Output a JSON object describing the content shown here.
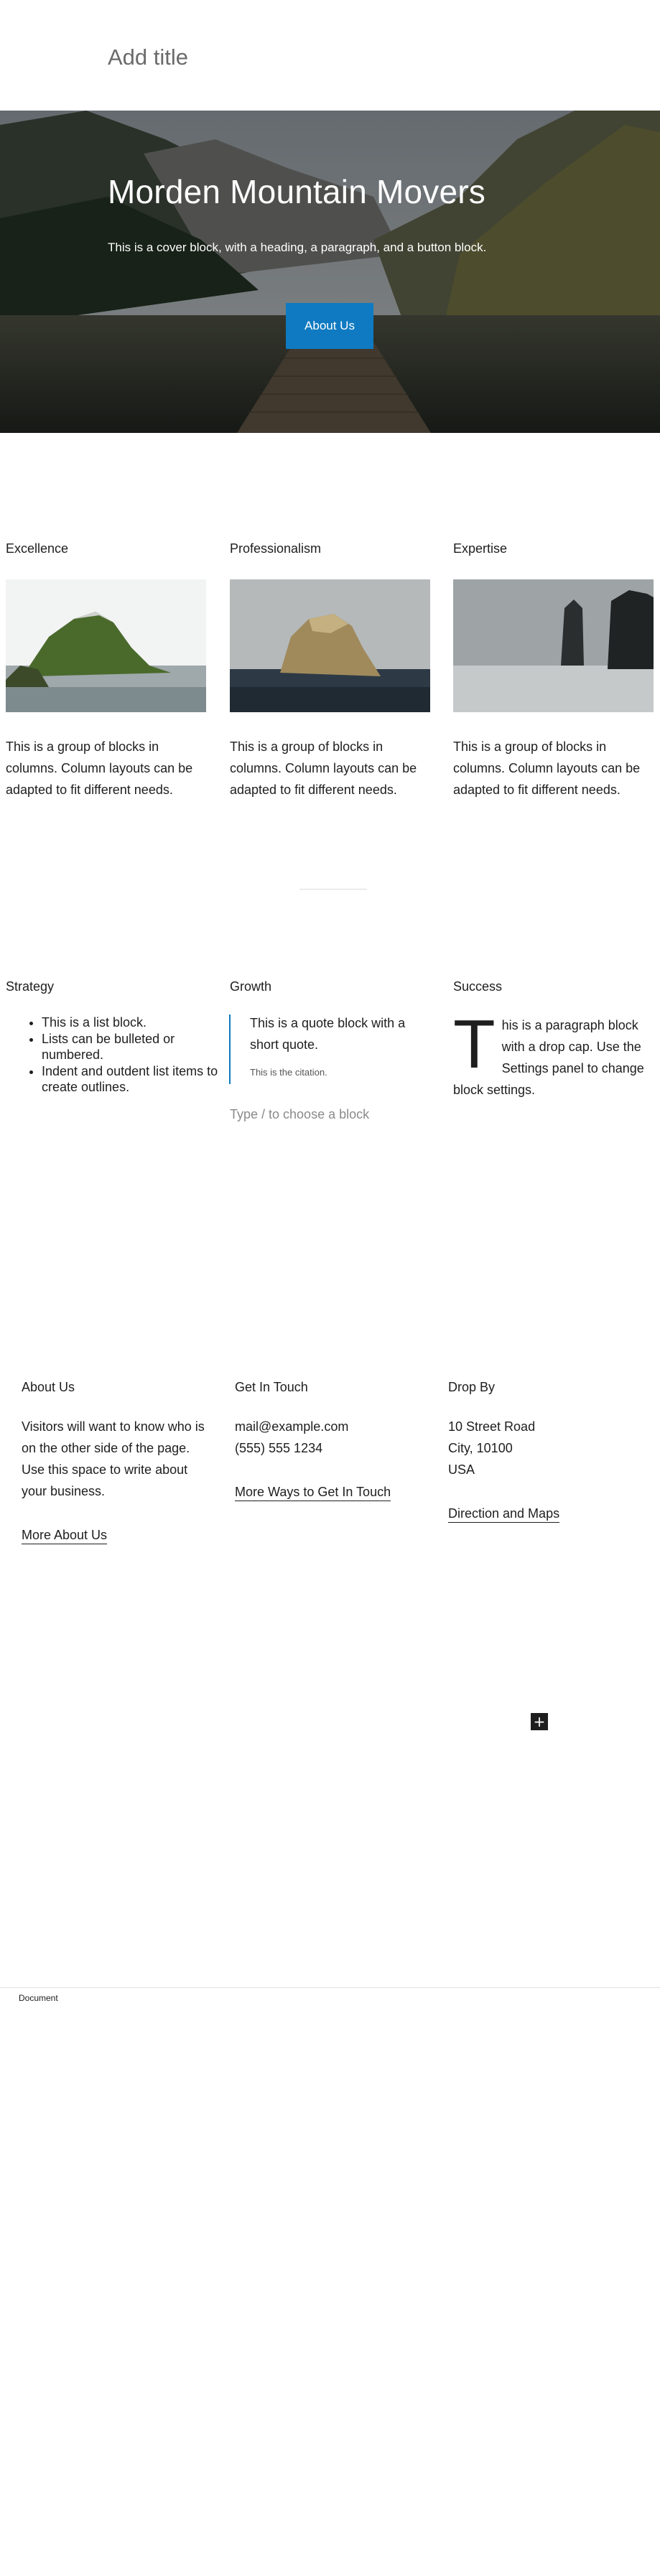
{
  "editor": {
    "title_placeholder": "Add title"
  },
  "cover": {
    "heading": "Morden Mountain Movers",
    "paragraph": "This is a cover block, with a heading, a paragraph, and a button block.",
    "button_label": "About Us"
  },
  "columns_1": [
    {
      "heading": "Excellence",
      "text": "This is a group of blocks in columns. Column layouts can be adapted to fit different needs."
    },
    {
      "heading": "Professionalism",
      "text": "This is a group of blocks in columns. Column layouts can be adapted to fit different needs."
    },
    {
      "heading": "Expertise",
      "text": "This is a group of blocks in columns. Column layouts can be adapted to fit different needs."
    }
  ],
  "columns_2": {
    "strategy": {
      "heading": "Strategy",
      "items": [
        "This is a list block.",
        "Lists can be bulleted or numbered.",
        "Indent and outdent list items to create outlines."
      ]
    },
    "growth": {
      "heading": "Growth",
      "quote": "This is a quote block with a short quote.",
      "citation": "This is the citation.",
      "appender_placeholder": "Type / to choose a block"
    },
    "success": {
      "heading": "Success",
      "dropcap": "T",
      "paragraph": "his is a paragraph block with a drop cap. Use the Settings panel to change block settings."
    }
  },
  "footer_columns": {
    "about": {
      "heading": "About Us",
      "text": "Visitors will want to know who is on the other side of the page. Use this space to write about your business.",
      "link": "More About Us"
    },
    "contact": {
      "heading": "Get In Touch",
      "email": "mail@example.com",
      "phone": "(555) 555 1234",
      "link": "More Ways to Get In Touch"
    },
    "visit": {
      "heading": "Drop By",
      "street": "10 Street Road",
      "city": "City, 10100",
      "country": "USA",
      "link": "Direction and Maps"
    }
  },
  "inserter": {
    "icon": "plus-icon",
    "glyph": "+"
  },
  "breadcrumb": {
    "label": "Document"
  },
  "colors": {
    "accent": "#0f7ac1",
    "text": "#1e1e1e",
    "placeholder": "#8a8a8a"
  }
}
